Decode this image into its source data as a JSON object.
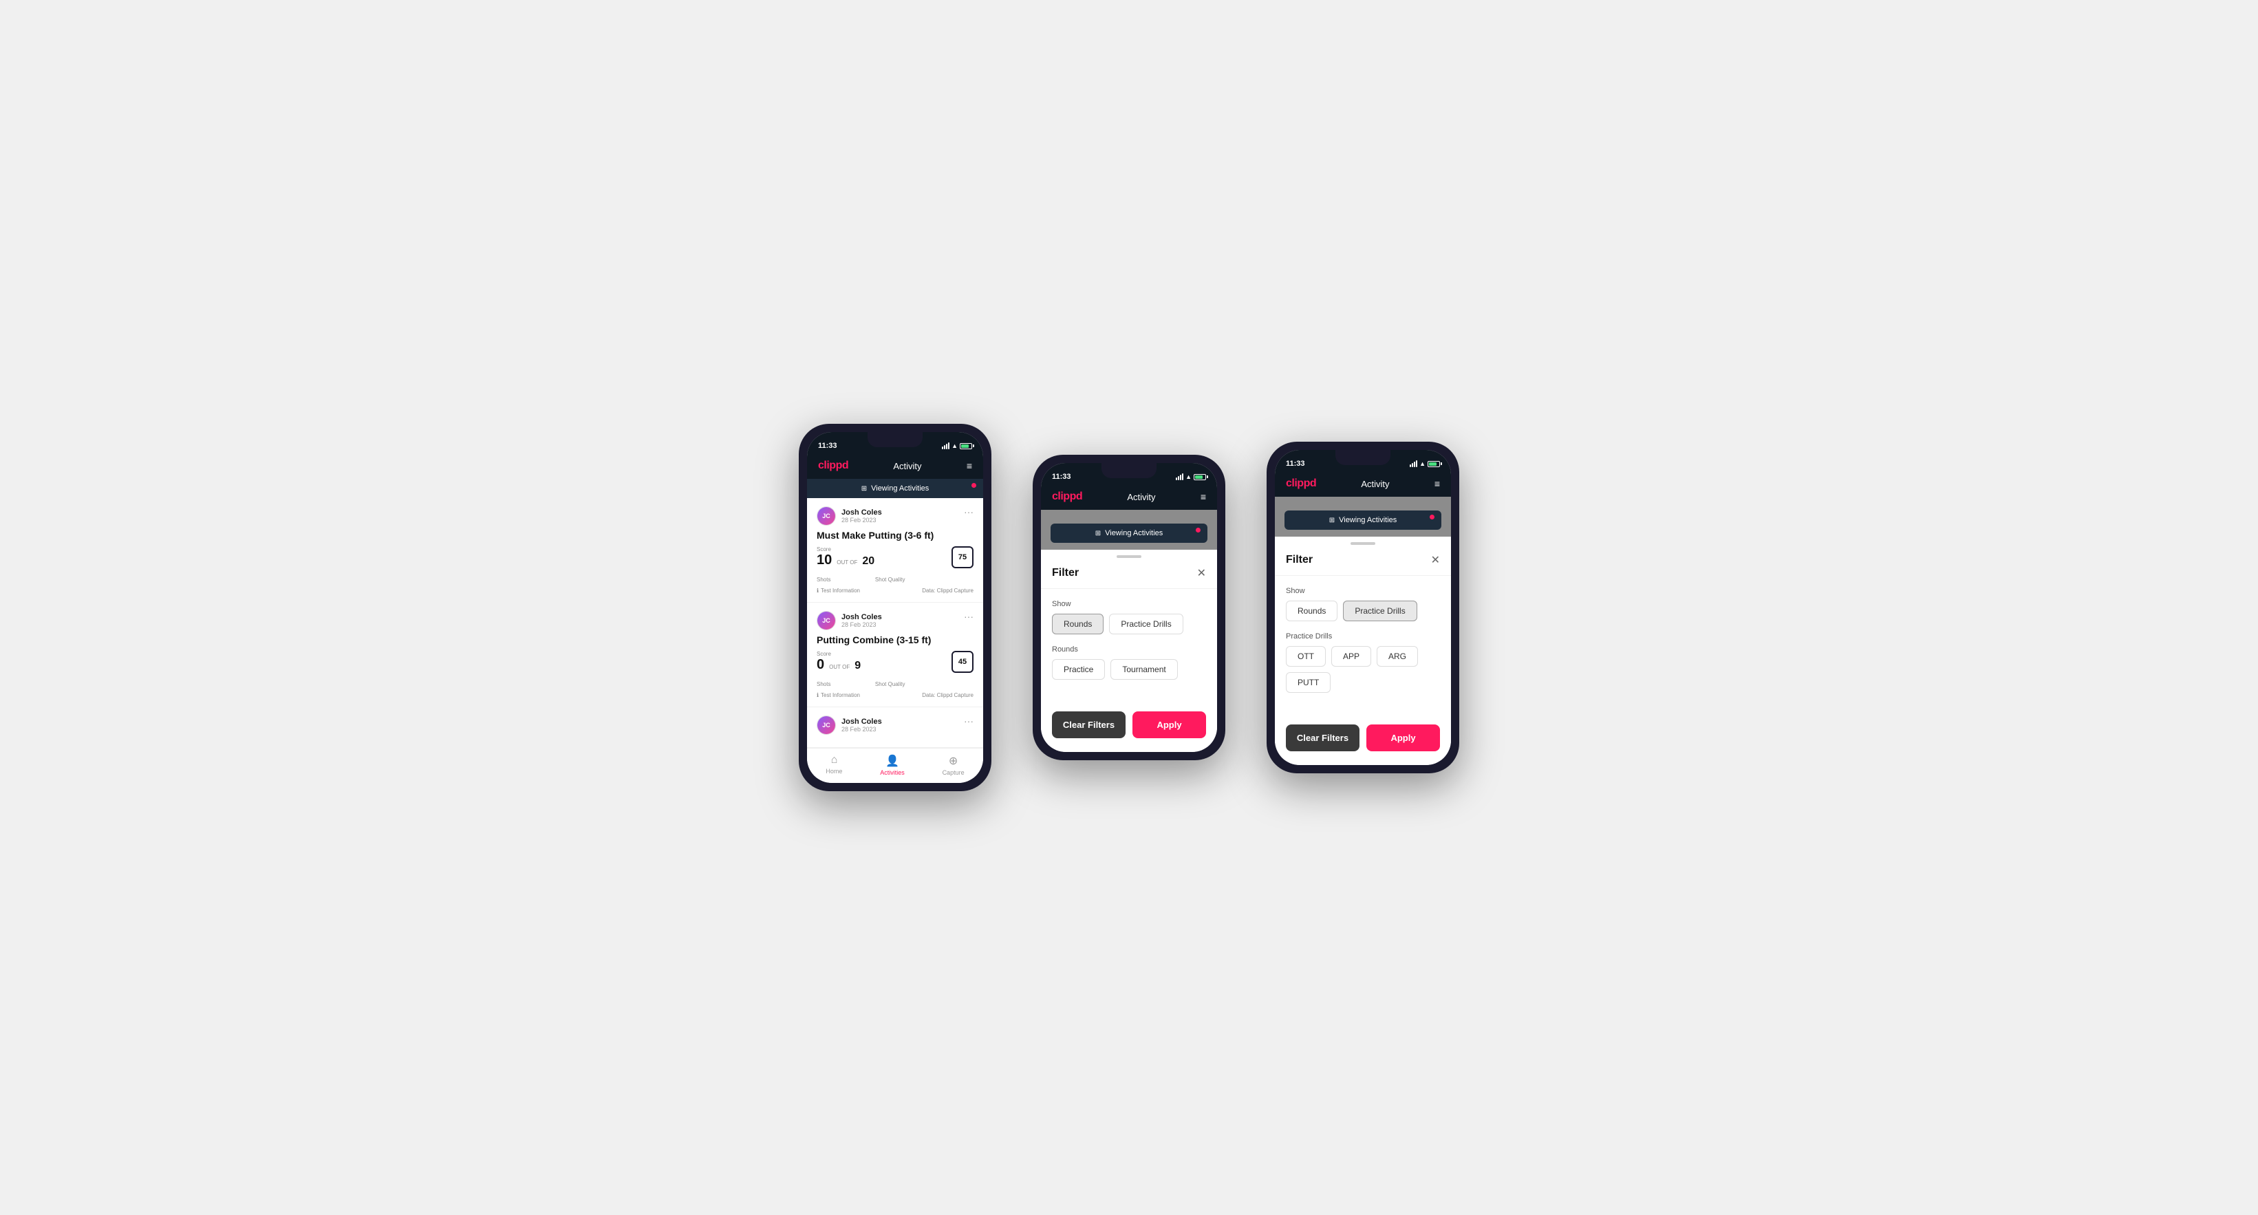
{
  "app": {
    "logo": "clippd",
    "header_title": "Activity",
    "time": "11:33",
    "menu_icon": "≡"
  },
  "viewing_bar": {
    "label": "Viewing Activities"
  },
  "activities": [
    {
      "user_name": "Josh Coles",
      "user_date": "28 Feb 2023",
      "title": "Must Make Putting (3-6 ft)",
      "score_label": "Score",
      "score": "10",
      "out_of_label": "OUT OF",
      "total": "20",
      "shots_label": "Shots",
      "shot_quality_label": "Shot Quality",
      "shot_quality": "75",
      "test_info": "Test Information",
      "data_source": "Data: Clippd Capture"
    },
    {
      "user_name": "Josh Coles",
      "user_date": "28 Feb 2023",
      "title": "Putting Combine (3-15 ft)",
      "score_label": "Score",
      "score": "0",
      "out_of_label": "OUT OF",
      "total": "9",
      "shots_label": "Shots",
      "shot_quality_label": "Shot Quality",
      "shot_quality": "45",
      "test_info": "Test Information",
      "data_source": "Data: Clippd Capture"
    },
    {
      "user_name": "Josh Coles",
      "user_date": "28 Feb 2023",
      "title": "",
      "score_label": "",
      "score": "",
      "out_of_label": "",
      "total": "",
      "shots_label": "",
      "shot_quality_label": "",
      "shot_quality": "",
      "test_info": "",
      "data_source": ""
    }
  ],
  "nav": {
    "home_label": "Home",
    "activities_label": "Activities",
    "capture_label": "Capture"
  },
  "filter": {
    "title": "Filter",
    "show_label": "Show",
    "rounds_label": "Rounds",
    "practice_drills_label": "Practice Drills",
    "rounds_section_label": "Rounds",
    "practice_label": "Practice",
    "tournament_label": "Tournament",
    "practice_drills_section_label": "Practice Drills",
    "ott_label": "OTT",
    "app_label": "APP",
    "arg_label": "ARG",
    "putt_label": "PUTT",
    "clear_label": "Clear Filters",
    "apply_label": "Apply"
  }
}
